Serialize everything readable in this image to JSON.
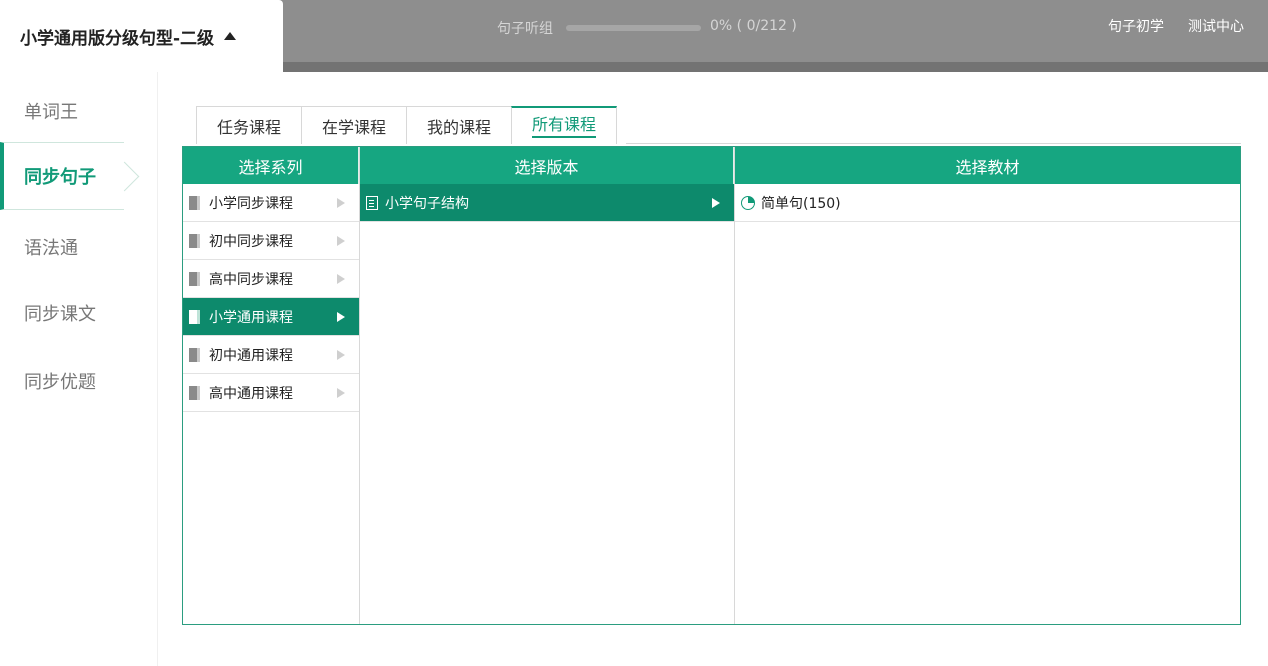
{
  "header": {
    "book_title": "小学通用版分级句型-二级",
    "listen_label": "句子听组",
    "progress_text": "0% ( 0/212 )",
    "progress_fraction": 0,
    "links": [
      "句子初学",
      "测试中心"
    ]
  },
  "sidebar": {
    "items": [
      {
        "label": "单词王"
      },
      {
        "label": "同步句子"
      },
      {
        "label": "语法通"
      },
      {
        "label": "同步课文"
      },
      {
        "label": "同步优题"
      }
    ],
    "active_index": 1
  },
  "tabs": {
    "items": [
      "任务课程",
      "在学课程",
      "我的课程",
      "所有课程"
    ],
    "active_index": 3
  },
  "panel": {
    "headers": [
      "选择系列",
      "选择版本",
      "选择教材"
    ],
    "series": [
      "小学同步课程",
      "初中同步课程",
      "高中同步课程",
      "小学通用课程",
      "初中通用课程",
      "高中通用课程"
    ],
    "series_selected_index": 3,
    "versions": [
      "小学句子结构"
    ],
    "textbooks": [
      "简单句(150)"
    ]
  },
  "colors": {
    "accent": "#16a681",
    "accent_dark": "#0d8a6c",
    "topbar": "#8e8e8e"
  }
}
